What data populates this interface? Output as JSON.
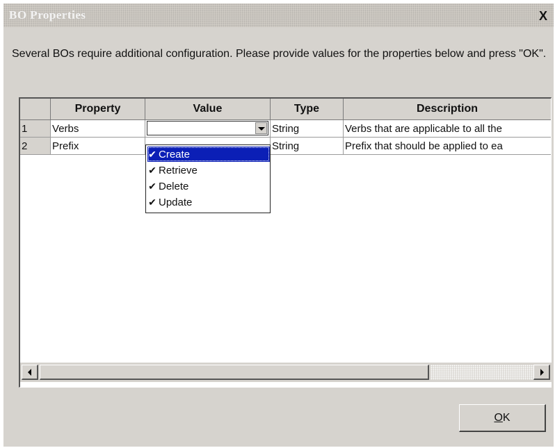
{
  "window": {
    "title": "BO Properties",
    "close_label": "X"
  },
  "message": "Several BOs require additional configuration. Please provide values for the properties below and press \"OK\".",
  "grid": {
    "columns": [
      "Property",
      "Value",
      "Type",
      "Description"
    ],
    "rows": [
      {
        "num": "1",
        "property": "Verbs",
        "value": "",
        "type": "String",
        "description": "Verbs that are applicable to all the"
      },
      {
        "num": "2",
        "property": "Prefix",
        "value": "",
        "type": "String",
        "description": "Prefix that should be applied to ea"
      }
    ]
  },
  "dropdown": {
    "items": [
      {
        "label": "Create",
        "checked": true,
        "selected": true
      },
      {
        "label": "Retrieve",
        "checked": true,
        "selected": false
      },
      {
        "label": "Delete",
        "checked": true,
        "selected": false
      },
      {
        "label": "Update",
        "checked": true,
        "selected": false
      }
    ],
    "check_glyph": "✔"
  },
  "buttons": {
    "ok_mnemonic": "O",
    "ok_rest": "K"
  },
  "colors": {
    "dialog_bg": "#d6d3ce",
    "selection": "#0b1fb6"
  },
  "icons": [
    "close-icon",
    "dropdown-arrow-icon",
    "scroll-left-icon",
    "scroll-right-icon",
    "checkmark-icon"
  ]
}
